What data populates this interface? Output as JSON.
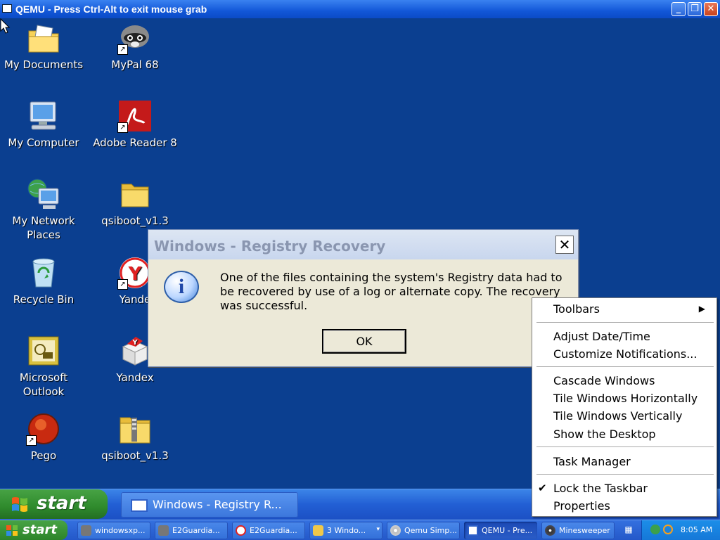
{
  "host_window": {
    "title": "QEMU - Press Ctrl-Alt to exit mouse grab",
    "controls": {
      "minimize": "_",
      "maximize": "❐",
      "close": "✕"
    }
  },
  "desktop_icons": [
    {
      "id": "my-documents",
      "label": "My Documents",
      "icon": "folder-documents-icon",
      "shortcut": false
    },
    {
      "id": "mypal",
      "label": "MyPal 68",
      "icon": "raccoon-icon",
      "shortcut": true
    },
    {
      "id": "my-computer",
      "label": "My Computer",
      "icon": "computer-icon",
      "shortcut": false
    },
    {
      "id": "adobe-reader",
      "label": "Adobe Reader 8",
      "icon": "pdf-icon",
      "shortcut": true
    },
    {
      "id": "my-network",
      "label": "My Network Places",
      "icon": "network-icon",
      "shortcut": false
    },
    {
      "id": "qsiboot-folder",
      "label": "qsiboot_v1.3",
      "icon": "folder-icon",
      "shortcut": false
    },
    {
      "id": "recycle-bin",
      "label": "Recycle Bin",
      "icon": "recycle-bin-icon",
      "shortcut": false
    },
    {
      "id": "yandex-browser",
      "label": "Yande",
      "icon": "yandex-icon",
      "shortcut": true
    },
    {
      "id": "outlook",
      "label": "Microsoft Outlook",
      "icon": "outlook-icon",
      "shortcut": false
    },
    {
      "id": "yandex-setup",
      "label": "Yandex",
      "icon": "yandex-box-icon",
      "shortcut": false
    },
    {
      "id": "pego",
      "label": "Pego",
      "icon": "pego-icon",
      "shortcut": true
    },
    {
      "id": "qsiboot-zip",
      "label": "qsiboot_v1.3",
      "icon": "zip-folder-icon",
      "shortcut": false
    }
  ],
  "dialog": {
    "title": "Windows - Registry Recovery",
    "close_glyph": "✕",
    "icon_glyph": "i",
    "message": "One of the files containing the system's Registry data had to be recovered by use of a log or alternate copy. The recovery was successful.",
    "ok_label": "OK"
  },
  "context_menu": {
    "items": [
      {
        "label": "Toolbars",
        "submenu": true,
        "checked": false
      },
      {
        "label": "Adjust Date/Time",
        "submenu": false,
        "checked": false
      },
      {
        "label": "Customize Notifications...",
        "submenu": false,
        "checked": false
      },
      {
        "label": "Cascade Windows",
        "submenu": false,
        "checked": false
      },
      {
        "label": "Tile Windows Horizontally",
        "submenu": false,
        "checked": false
      },
      {
        "label": "Tile Windows Vertically",
        "submenu": false,
        "checked": false
      },
      {
        "label": "Show the Desktop",
        "submenu": false,
        "checked": false
      },
      {
        "label": "Task Manager",
        "submenu": false,
        "checked": false
      },
      {
        "label": "Lock the Taskbar",
        "submenu": false,
        "checked": true
      },
      {
        "label": "Properties",
        "submenu": false,
        "checked": false
      }
    ],
    "arrow_glyph": "▶",
    "check_glyph": "✔"
  },
  "guest_taskbar": {
    "start_label": "start",
    "task_label": "Windows - Registry R..."
  },
  "host_taskbar": {
    "start_label": "start",
    "buttons": [
      {
        "label": "windowsxp...",
        "icon": "raccoon-icon"
      },
      {
        "label": "E2Guardia...",
        "icon": "raccoon-icon"
      },
      {
        "label": "E2Guardia...",
        "icon": "yandex-icon"
      },
      {
        "label": "3 Windo...",
        "icon": "folder-icon",
        "dropdown": true
      },
      {
        "label": "Qemu Simp...",
        "icon": "cd-icon"
      },
      {
        "label": "QEMU - Pre...",
        "icon": "window-icon",
        "active": true
      },
      {
        "label": "Minesweeper",
        "icon": "mine-icon"
      }
    ],
    "tray": {
      "clock": "8:05 AM"
    },
    "keyboard_glyph": "▦",
    "dropdown_glyph": "▾"
  }
}
